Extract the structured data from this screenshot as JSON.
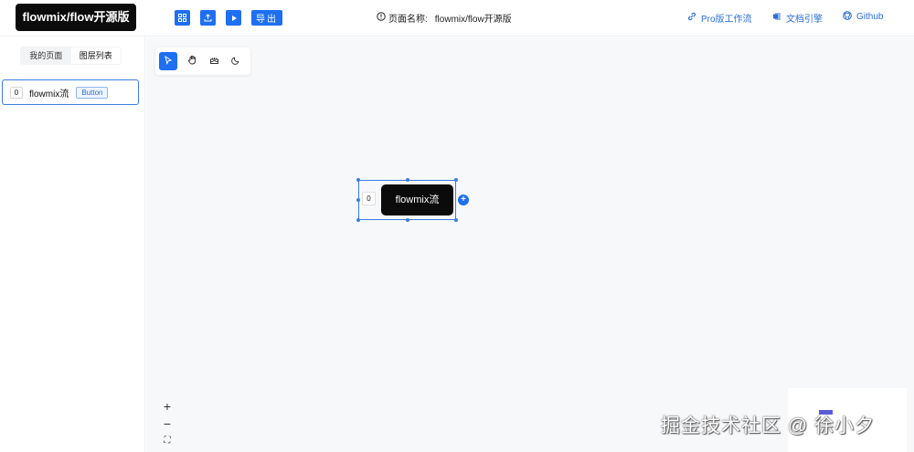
{
  "header": {
    "logo": "flowmix/flow开源版",
    "toolbar": {
      "icons": [
        "grid-icon",
        "upload-icon",
        "play-icon"
      ],
      "export_label": "导出"
    },
    "page_name_label": "页面名称:",
    "page_name_value": "flowmix/flow开源版",
    "links": [
      {
        "label": "Pro版工作流",
        "icon": "link-icon"
      },
      {
        "label": "文档引擎",
        "icon": "word-doc-icon"
      },
      {
        "label": "Github",
        "icon": "github-icon"
      }
    ]
  },
  "sidebar": {
    "tabs": [
      {
        "label": "我的页面",
        "active": false
      },
      {
        "label": "图层列表",
        "active": true
      }
    ],
    "layers": [
      {
        "index": "0",
        "name": "flowmix流",
        "type": "Button"
      }
    ]
  },
  "canvas": {
    "tools": [
      "select-cursor-icon",
      "hand-pan-icon",
      "cake-icon",
      "moon-icon"
    ],
    "node": {
      "index": "0",
      "label": "flowmix流"
    },
    "zoom": {
      "in": "+",
      "out": "−",
      "fit": "⛶"
    }
  },
  "watermark": "掘金技术社区 @ 徐小夕",
  "colors": {
    "accent": "#1e6ff1",
    "dark": "#0b0b0b",
    "canvas": "#f7f8fa"
  }
}
